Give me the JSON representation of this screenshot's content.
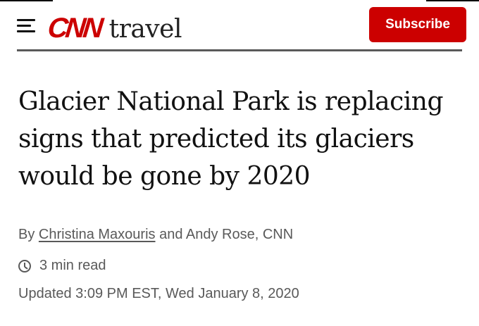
{
  "header": {
    "logo_brand": "CNN",
    "logo_section": "travel",
    "subscribe_label": "Subscribe"
  },
  "article": {
    "headline": "Glacier National Park is replacing signs that predicted its glaciers would be gone by 2020",
    "byline_prefix": "By",
    "author_1": "Christina Maxouris",
    "byline_join": "and Andy Rose, CNN",
    "read_time": "3 min read",
    "updated": "Updated 3:09 PM EST, Wed January 8, 2020"
  },
  "colors": {
    "brand_red": "#cc0000",
    "meta_gray": "#595959"
  },
  "icons": {
    "menu": "hamburger-menu-icon",
    "read_time": "clock-icon"
  }
}
